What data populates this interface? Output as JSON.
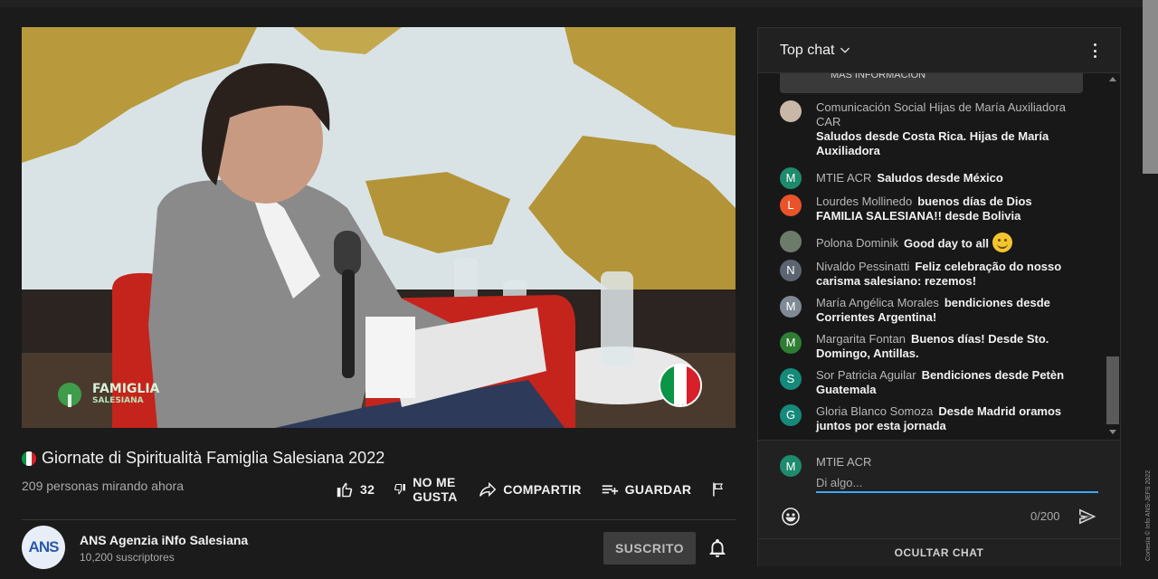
{
  "video": {
    "title": "Giornate di Spiritualità Famiglia Salesiana 2022",
    "title_flag_icon": "italy-flag-icon",
    "viewers": "209 personas mirando ahora",
    "watermark": {
      "line1": "FAMIGLIA",
      "line2": "SALESIANA"
    },
    "flag_colors": [
      "#0c9447",
      "#ffffff",
      "#d81f2a"
    ]
  },
  "actions": {
    "like_count": "32",
    "dislike_label": "NO ME GUSTA",
    "share_label": "COMPARTIR",
    "save_label": "GUARDAR"
  },
  "channel": {
    "name": "ANS Agenzia iNfo Salesiana",
    "subscribers": "10,200 suscriptores",
    "avatar_text": "ANS",
    "subscribe_label": "SUSCRITO"
  },
  "chat": {
    "title": "Top chat",
    "pinned_fragment": "MAS INFORMACIÓN",
    "messages": [
      {
        "author": "Comunicación Social Hijas de María Auxiliadora CAR",
        "text": "Saludos desde Costa Rica. Hijas de María Auxiliadora",
        "avatar_letter": "",
        "avatar_color": "#c9b8a8"
      },
      {
        "author": "MTIE ACR",
        "text": "Saludos desde México",
        "avatar_letter": "M",
        "avatar_color": "#1e8a6e"
      },
      {
        "author": "Lourdes Mollinedo",
        "text": "buenos días de Dios FAMILIA SALESIANA!! desde Bolivia",
        "avatar_letter": "L",
        "avatar_color": "#e8532a"
      },
      {
        "author": "Polona Dominik",
        "text": "Good day to all",
        "avatar_letter": "",
        "avatar_color": "#6d7b6a",
        "emoji": "smile-emoji"
      },
      {
        "author": "Nivaldo Pessinatti",
        "text": "Feliz celebração do nosso carisma salesiano: rezemos!",
        "avatar_letter": "N",
        "avatar_color": "#5b6470"
      },
      {
        "author": "María Angélica Morales",
        "text": "bendiciones desde Corrientes Argentina!",
        "avatar_letter": "M",
        "avatar_color": "#7f8a94"
      },
      {
        "author": "Margarita Fontan",
        "text": "Buenos días! Desde Sto. Domingo, Antillas.",
        "avatar_letter": "M",
        "avatar_color": "#2e7d32"
      },
      {
        "author": "Sor Patricia Aguilar",
        "text": "Bendiciones desde Petèn Guatemala",
        "avatar_letter": "S",
        "avatar_color": "#15897a"
      },
      {
        "author": "Gloria Blanco Somoza",
        "text": "Desde Madrid oramos juntos por esta jornada",
        "avatar_letter": "G",
        "avatar_color": "#15897a"
      }
    ],
    "composer": {
      "user": "MTIE ACR",
      "avatar_letter": "M",
      "placeholder": "Di algo...",
      "counter": "0/200"
    },
    "hide_label": "OCULTAR CHAT"
  },
  "courtesy": "Cortesía © Info ANS-JEFS 2022"
}
